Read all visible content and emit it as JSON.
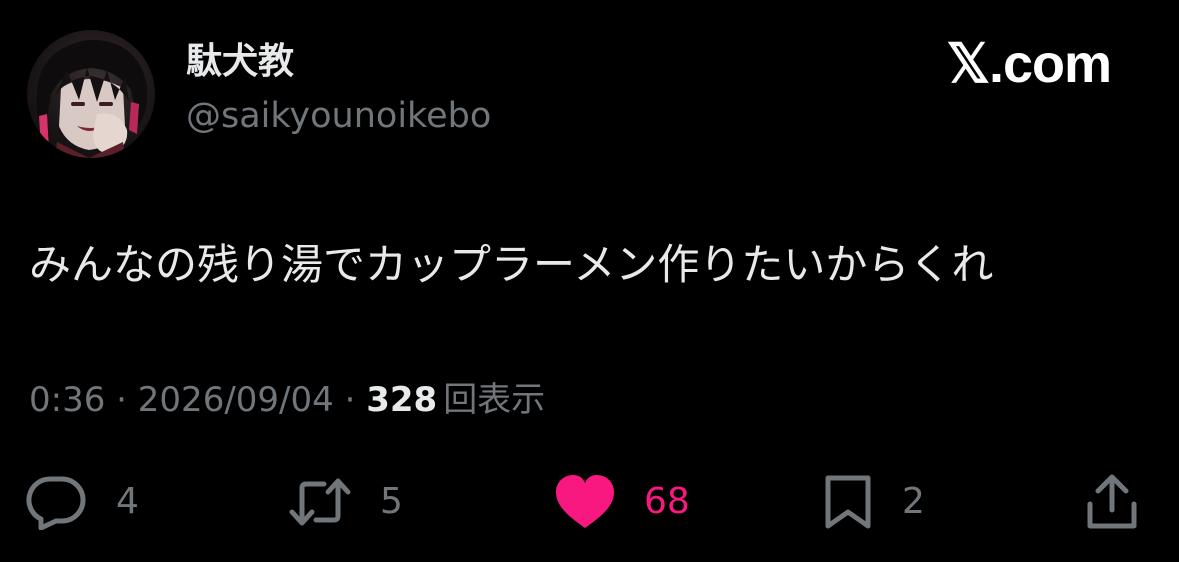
{
  "user": {
    "display_name": "駄犬教",
    "handle": "@saikyounoikebo"
  },
  "brand": {
    "label": "𝕏.com"
  },
  "tweet": {
    "text": "みんなの残り湯でカップラーメン作りたいからくれ",
    "time": "0:36",
    "separator": "·",
    "date": "2026/09/04",
    "views_count": "328",
    "views_label": "回表示"
  },
  "actions": {
    "reply_count": "4",
    "retweet_count": "5",
    "like_count": "68",
    "bookmark_count": "2"
  },
  "colors": {
    "background": "#000000",
    "text_primary": "#e7e9ea",
    "text_secondary": "#71767b",
    "like_pink": "#f91880"
  },
  "icons": [
    "avatar",
    "reply-icon",
    "retweet-icon",
    "heart-icon",
    "bookmark-icon",
    "share-icon"
  ]
}
